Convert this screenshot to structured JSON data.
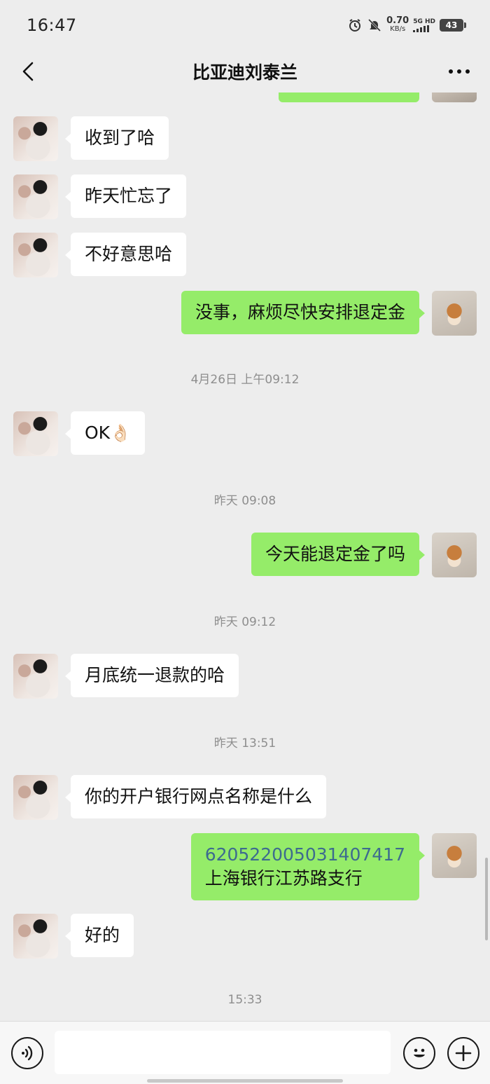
{
  "status_bar": {
    "time": "16:47",
    "net_speed": "0.70",
    "net_unit": "KB/s",
    "signal_label": "5G HD",
    "battery": "43"
  },
  "header": {
    "title": "比亚迪刘泰兰"
  },
  "messages": [
    {
      "from": "contact",
      "text": "收到了哈"
    },
    {
      "from": "contact",
      "text": "昨天忙忘了"
    },
    {
      "from": "contact",
      "text": "不好意思哈"
    },
    {
      "from": "me",
      "text": "没事，麻烦尽快安排退定金"
    },
    {
      "type": "time",
      "text": "4月26日 上午09:12"
    },
    {
      "from": "contact",
      "text": "OK",
      "emoji": "👌🏻"
    },
    {
      "type": "time",
      "text": "昨天 09:08"
    },
    {
      "from": "me",
      "text": "今天能退定金了吗"
    },
    {
      "type": "time",
      "text": "昨天 09:12"
    },
    {
      "from": "contact",
      "text": "月底统一退款的哈"
    },
    {
      "type": "time",
      "text": "昨天 13:51"
    },
    {
      "from": "contact",
      "text": "你的开户银行网点名称是什么"
    },
    {
      "from": "me",
      "line1": "6205220050314​07417",
      "line2": "上海银行江苏路支行"
    },
    {
      "from": "contact",
      "text": "好的"
    },
    {
      "type": "time",
      "text": "15:33"
    }
  ],
  "input_bar": {
    "placeholder": ""
  },
  "colors": {
    "background": "#ededed",
    "my_bubble": "#95ec69",
    "their_bubble": "#ffffff",
    "account_link": "#3d6b8f"
  }
}
